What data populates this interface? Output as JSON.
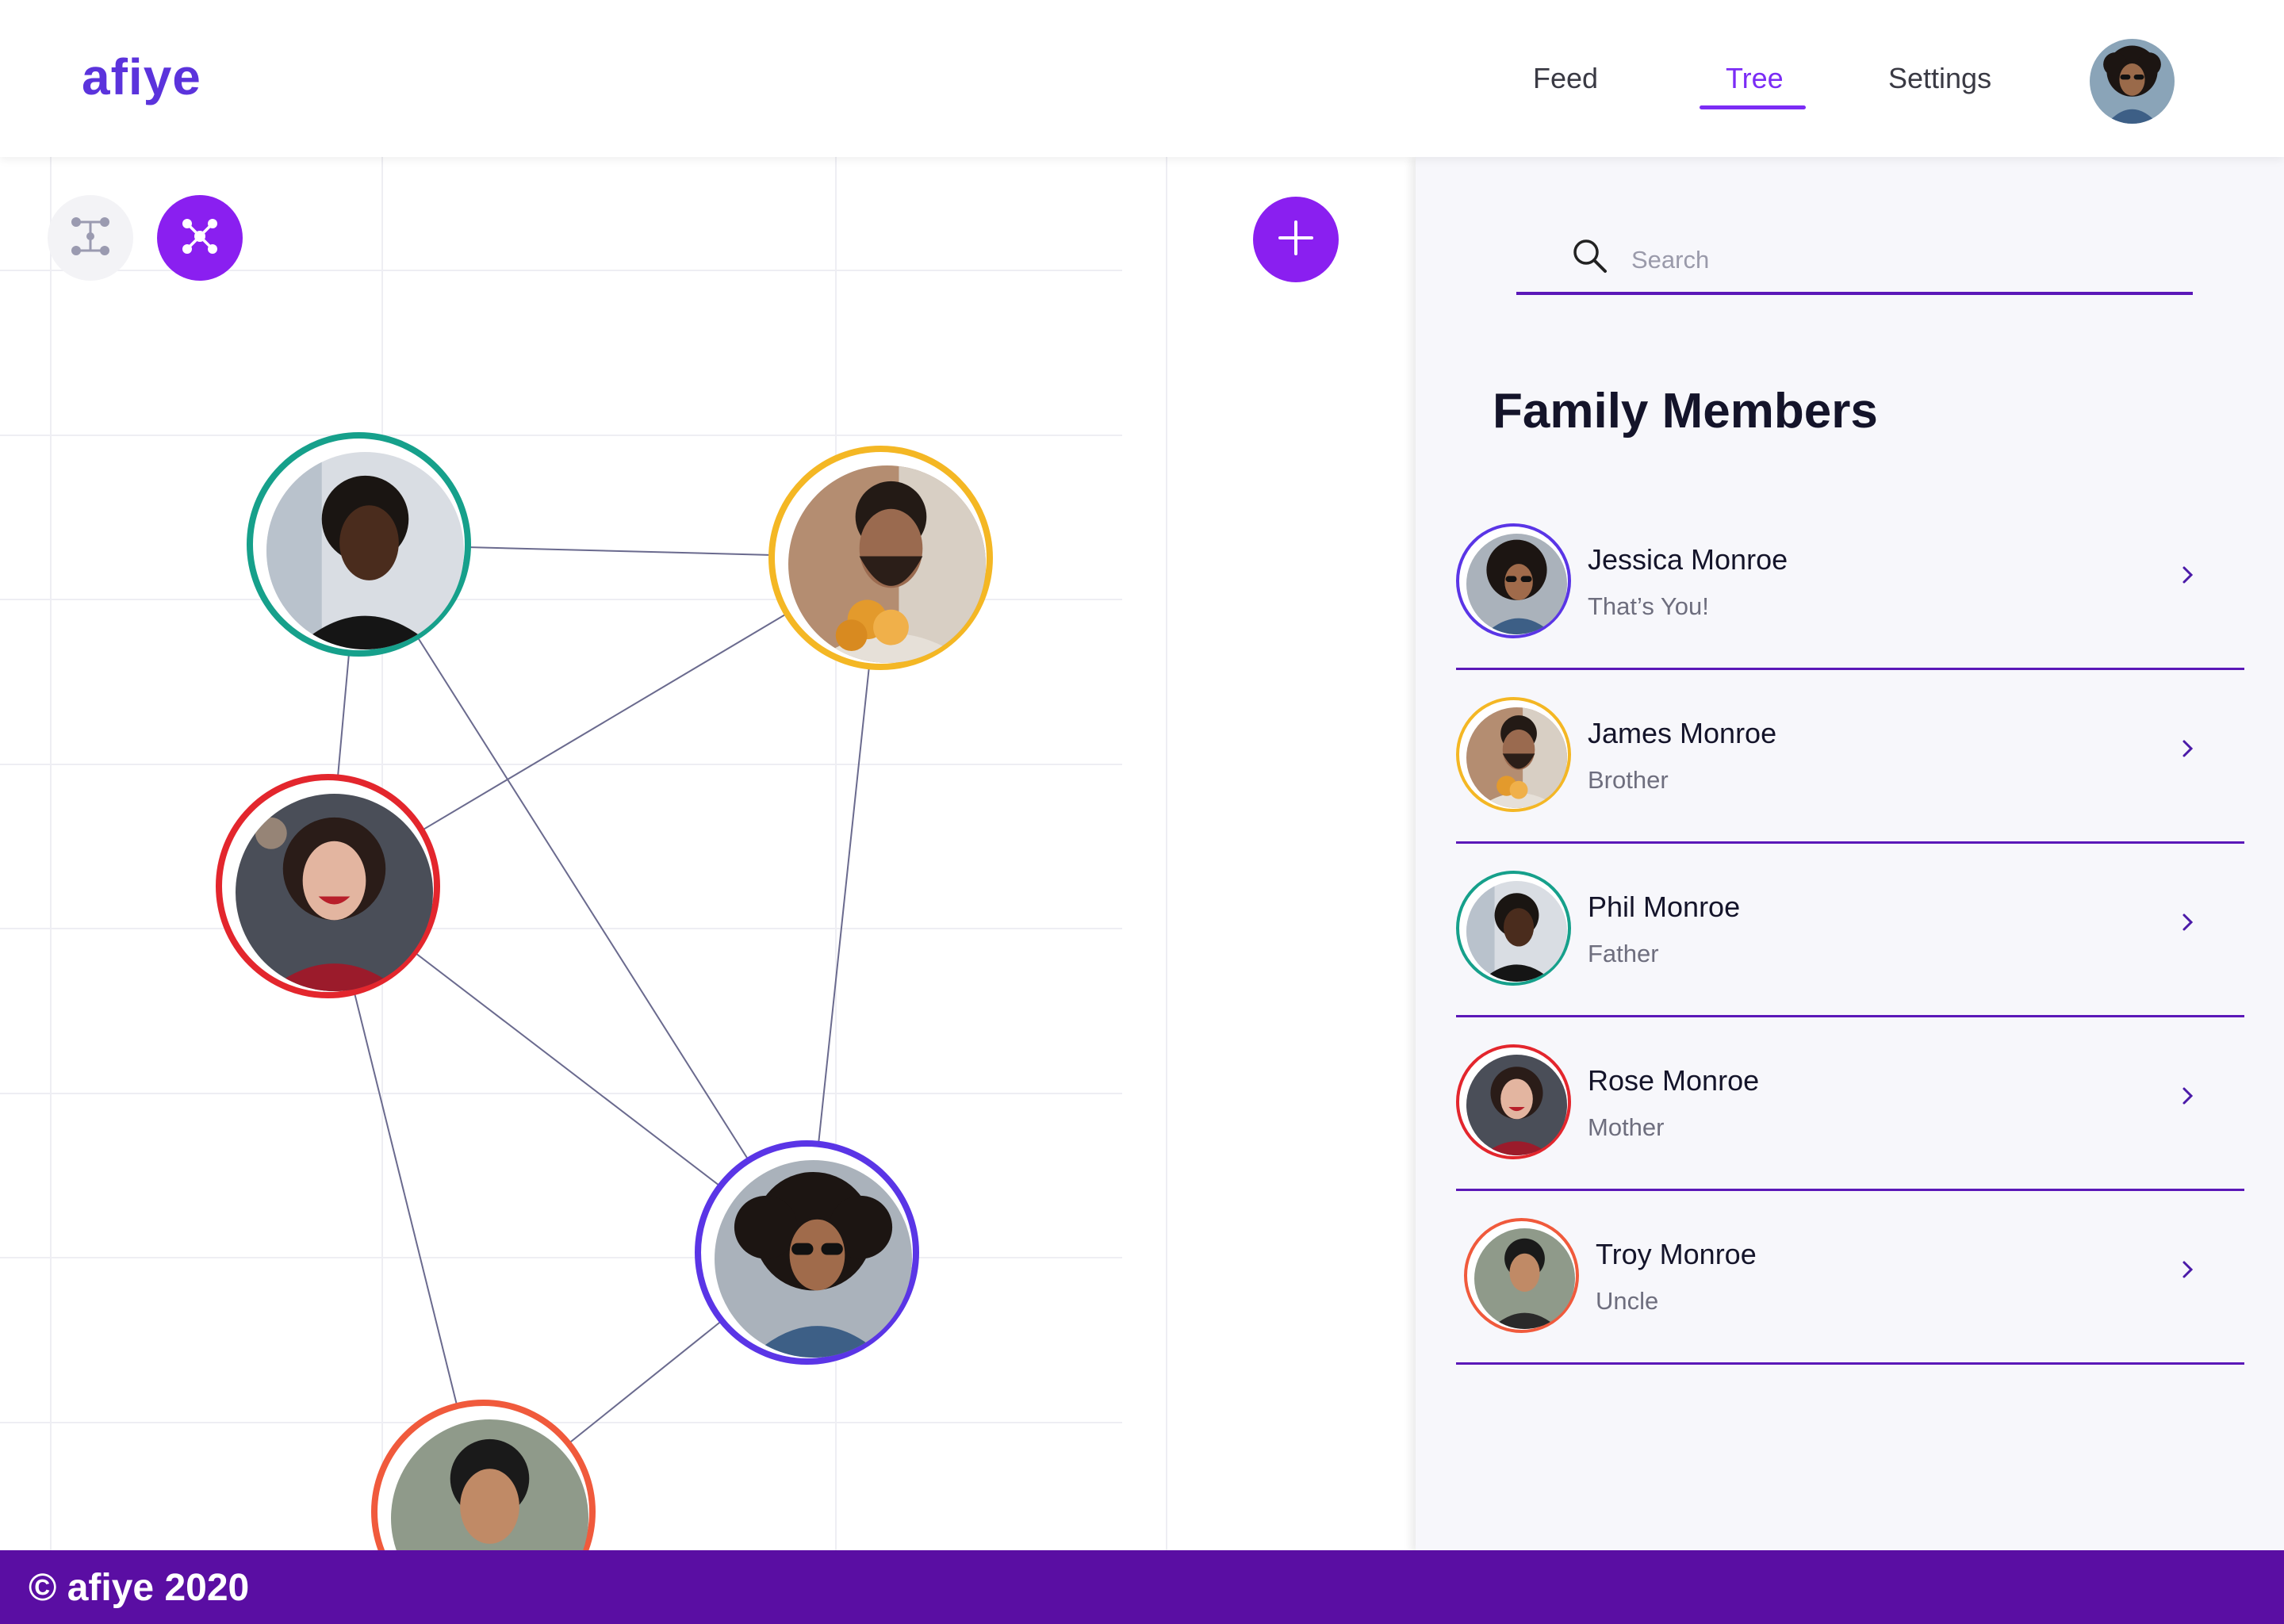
{
  "app": {
    "logo": "afiye"
  },
  "nav": {
    "feed": "Feed",
    "tree": "Tree",
    "settings": "Settings",
    "active": "Tree"
  },
  "toolbar": {
    "tree_view_icon": "hierarchy-icon",
    "graph_view_icon": "graph-network-icon",
    "add_icon": "plus-icon"
  },
  "graph": {
    "nodes": [
      {
        "id": "phil",
        "ring_color": "#16a08b"
      },
      {
        "id": "james",
        "ring_color": "#f4b724"
      },
      {
        "id": "rose",
        "ring_color": "#e3262d"
      },
      {
        "id": "jessica",
        "ring_color": "#5a35e6"
      },
      {
        "id": "troy",
        "ring_color": "#f05a3c"
      }
    ],
    "edges": [
      [
        "phil",
        "james"
      ],
      [
        "phil",
        "rose"
      ],
      [
        "phil",
        "jessica"
      ],
      [
        "james",
        "rose"
      ],
      [
        "james",
        "jessica"
      ],
      [
        "rose",
        "jessica"
      ],
      [
        "rose",
        "troy"
      ],
      [
        "jessica",
        "troy"
      ]
    ]
  },
  "sidebar": {
    "search_placeholder": "Search",
    "title": "Family Members",
    "members": [
      {
        "name": "Jessica Monroe",
        "relation": "That’s You!",
        "ring_color": "#5a35e6"
      },
      {
        "name": "James Monroe",
        "relation": "Brother",
        "ring_color": "#f4b724"
      },
      {
        "name": "Phil Monroe",
        "relation": "Father",
        "ring_color": "#16a08b"
      },
      {
        "name": "Rose Monroe",
        "relation": "Mother",
        "ring_color": "#e3262d"
      },
      {
        "name": "Troy Monroe",
        "relation": "Uncle",
        "ring_color": "#f05a3c"
      }
    ]
  },
  "colors": {
    "accent": "#8a1ff0",
    "brand": "#5b33dc",
    "footer": "#5a0ea3"
  },
  "footer": {
    "text": "© afiye 2020"
  }
}
